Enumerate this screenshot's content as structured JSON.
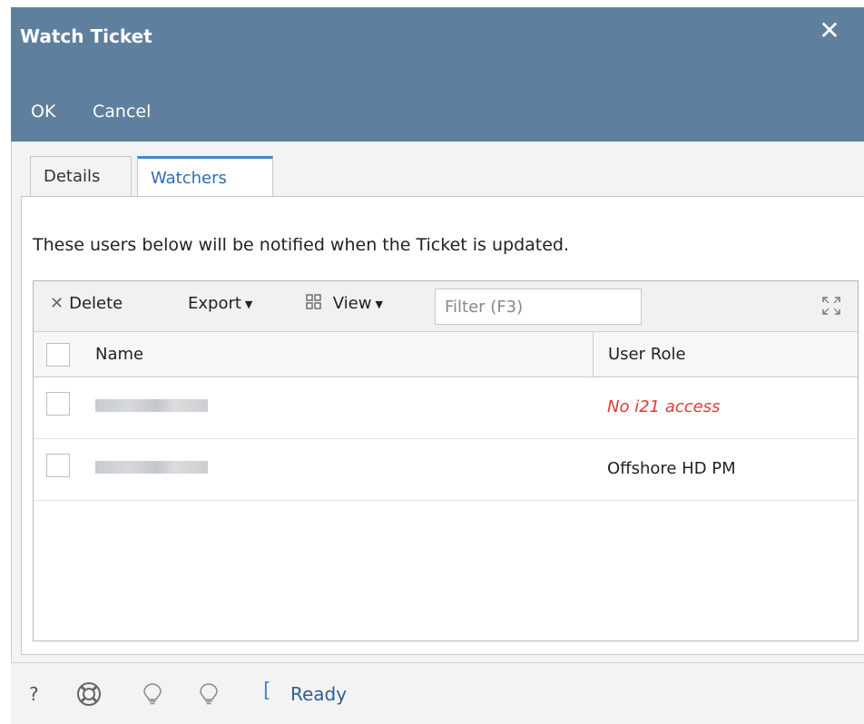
{
  "window": {
    "title": "Watch Ticket",
    "close_label": "✕"
  },
  "header": {
    "ok_label": "OK",
    "cancel_label": "Cancel"
  },
  "tabs": [
    {
      "label": "Details",
      "active": false
    },
    {
      "label": "Watchers",
      "active": true
    }
  ],
  "watchers": {
    "notice": "These users below will be notified when the Ticket is updated.",
    "toolbar": {
      "delete_label": "Delete",
      "export_label": "Export",
      "view_label": "View",
      "filter_placeholder": "Filter (F3)"
    },
    "columns": [
      "Name",
      "User Role"
    ],
    "rows": [
      {
        "name": "",
        "role": "No i21 access",
        "role_status": "warning"
      },
      {
        "name": "",
        "role": "Offshore HD PM",
        "role_status": "normal"
      }
    ]
  },
  "statusbar": {
    "help_label": "?",
    "status": "Ready"
  },
  "colors": {
    "header_bg": "#5f7f9e",
    "tab_active": "#4a86c8",
    "warning_text": "#e53935",
    "status_text": "#2d5f91"
  },
  "icons": [
    "close-icon",
    "delete-icon",
    "view-grid-icon",
    "chevron-down-icon",
    "expand-icon",
    "help-icon",
    "support-icon",
    "lightbulb-icon"
  ]
}
